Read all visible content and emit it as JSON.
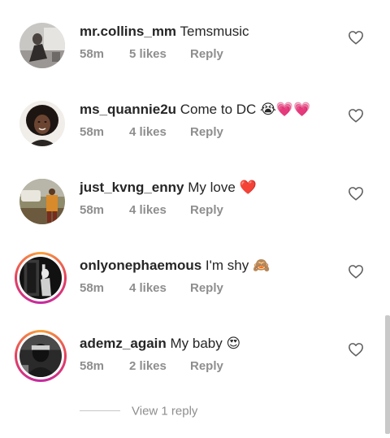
{
  "comments": [
    {
      "username": "mr.collins_mm",
      "text": "Temsmusic",
      "time": "58m",
      "likes": "5 likes",
      "reply": "Reply",
      "avatar_icon": "photo-avatar",
      "has_story_ring": false
    },
    {
      "username": "ms_quannie2u",
      "text": "Come to DC 😭💗💗",
      "time": "58m",
      "likes": "4 likes",
      "reply": "Reply",
      "avatar_icon": "photo-avatar",
      "has_story_ring": false
    },
    {
      "username": "just_kvng_enny",
      "text": "My love ",
      "text_emoji": "❤️",
      "time": "58m",
      "likes": "4 likes",
      "reply": "Reply",
      "avatar_icon": "photo-avatar",
      "has_story_ring": false
    },
    {
      "username": "onlyonephaemous",
      "text": "I'm shy 🙈",
      "time": "58m",
      "likes": "4 likes",
      "reply": "Reply",
      "avatar_icon": "photo-avatar",
      "has_story_ring": true
    },
    {
      "username": "ademz_again",
      "text": "My baby 😍",
      "time": "58m",
      "likes": "2 likes",
      "reply": "Reply",
      "avatar_icon": "photo-avatar",
      "has_story_ring": true
    }
  ],
  "view_replies": "View 1 reply",
  "icons": {
    "like": "heart-outline-icon"
  },
  "colors": {
    "username": "#262626",
    "meta": "#8e8e8e",
    "story_ring_start": "#f9a23b",
    "story_ring_end": "#c32aa3"
  }
}
